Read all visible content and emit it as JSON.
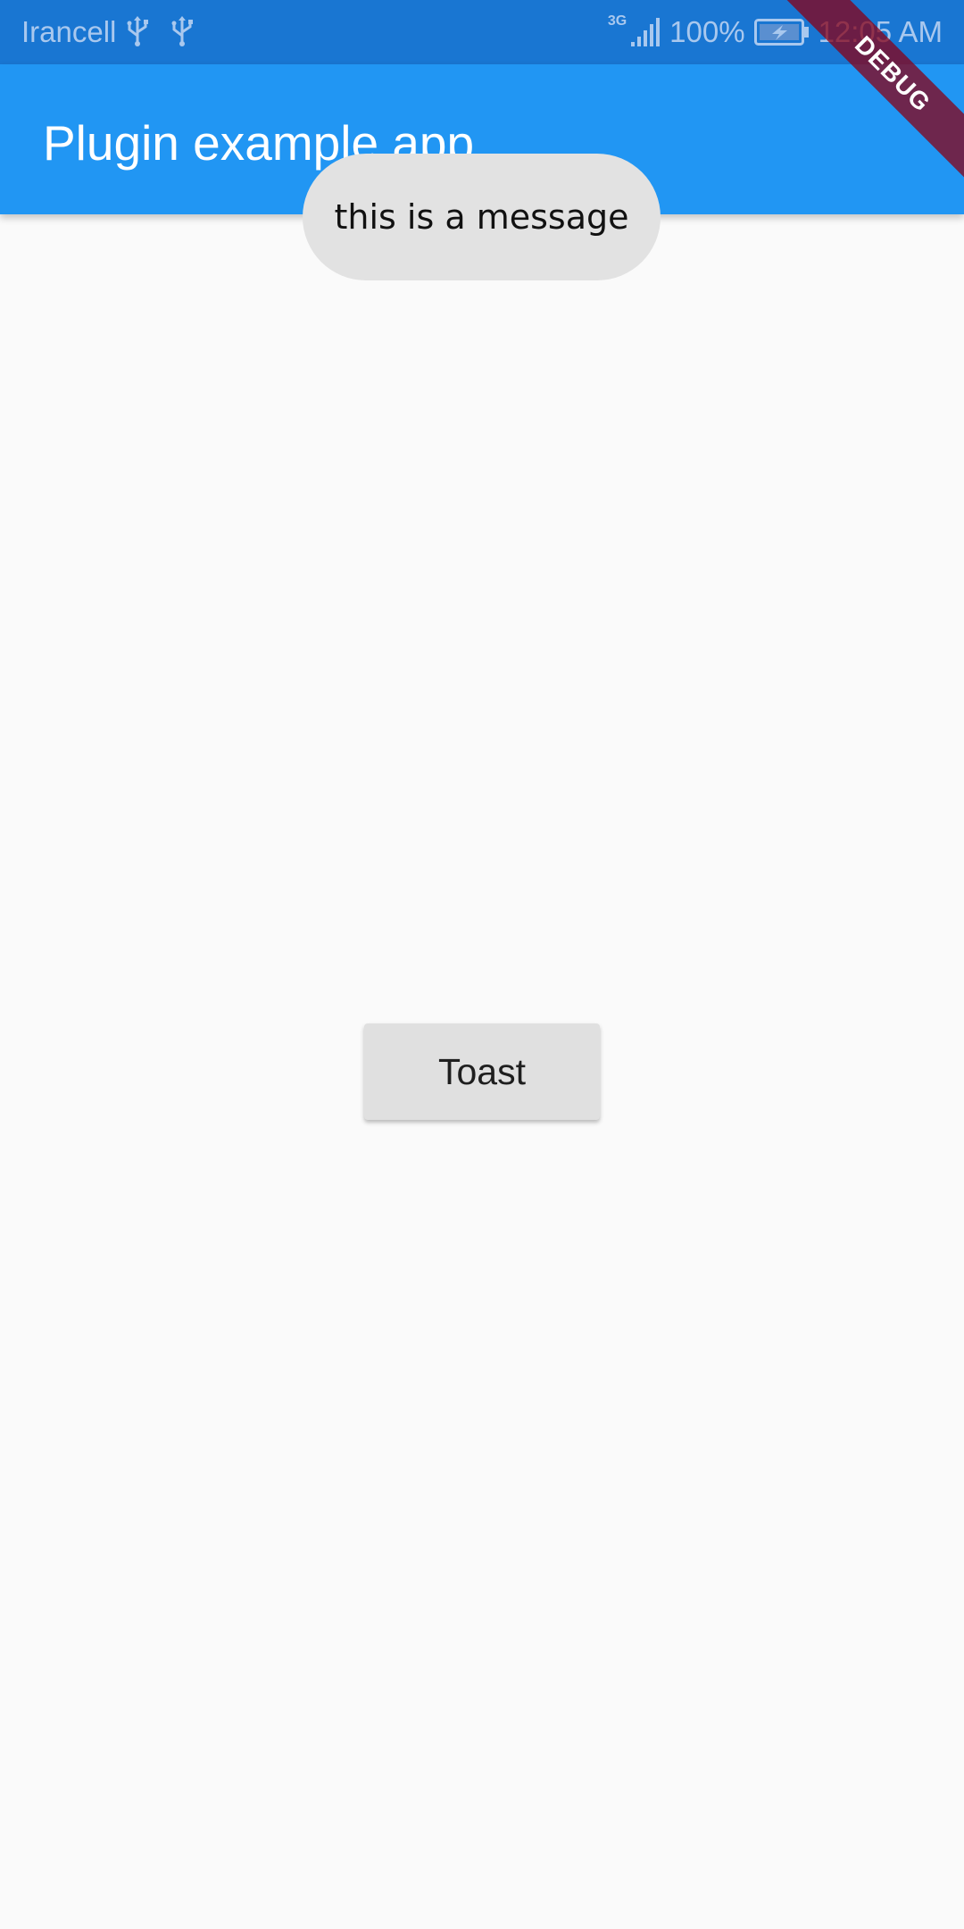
{
  "status_bar": {
    "carrier": "Irancell",
    "network_type": "3G",
    "battery": "100%",
    "time": "12:05 AM",
    "icons": [
      "usb-icon",
      "usb-icon",
      "signal-icon",
      "battery-charging-icon"
    ]
  },
  "app_bar": {
    "title": "Plugin example app"
  },
  "debug_banner": {
    "label": "DEBUG"
  },
  "toast": {
    "message": "this is a message"
  },
  "main": {
    "button_label": "Toast"
  },
  "colors": {
    "status_bar": "#1976d2",
    "app_bar": "#2196f3",
    "background": "#fafafa",
    "toast_bg": "#e2e2e2",
    "button_bg": "#e0e0e0",
    "debug_banner": "#880015"
  }
}
